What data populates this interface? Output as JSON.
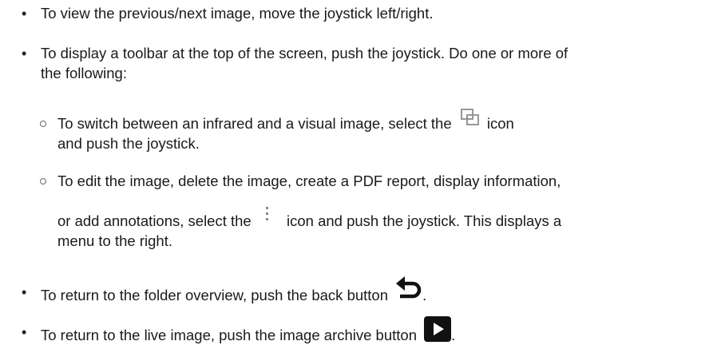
{
  "bullets": [
    {
      "lines": [
        "To view the previous/next image, move the joystick left/right."
      ]
    },
    {
      "lines": [
        "To display a toolbar at the top of the screen, push the joystick. Do one or more of",
        "the following:"
      ]
    },
    {
      "sub": [
        {
          "line1_before_icon": "To switch between an infrared and a visual image, select the",
          "icon": "switch-image-icon",
          "line1_after_icon": "icon",
          "line2": "and push the joystick."
        },
        {
          "line1": "To edit the image, delete the image, create a PDF report, display information,",
          "line2_before_icon": "or add annotations, select the",
          "icon": "more-options-icon",
          "line2_after_icon": "icon and push the joystick. This displays a",
          "line3": "menu to the right."
        }
      ]
    },
    {
      "text_before_icon": "To return to the folder overview, push the back button",
      "icon": "back-arrow-icon",
      "text_after_icon": "."
    },
    {
      "text_before_icon": "To return to the live image, push the image archive button",
      "icon": "play-icon",
      "text_after_icon": "."
    }
  ],
  "colors": {
    "text": "#1a1a1a",
    "icon_gray": "#8c8c8c",
    "icon_black": "#111111"
  }
}
